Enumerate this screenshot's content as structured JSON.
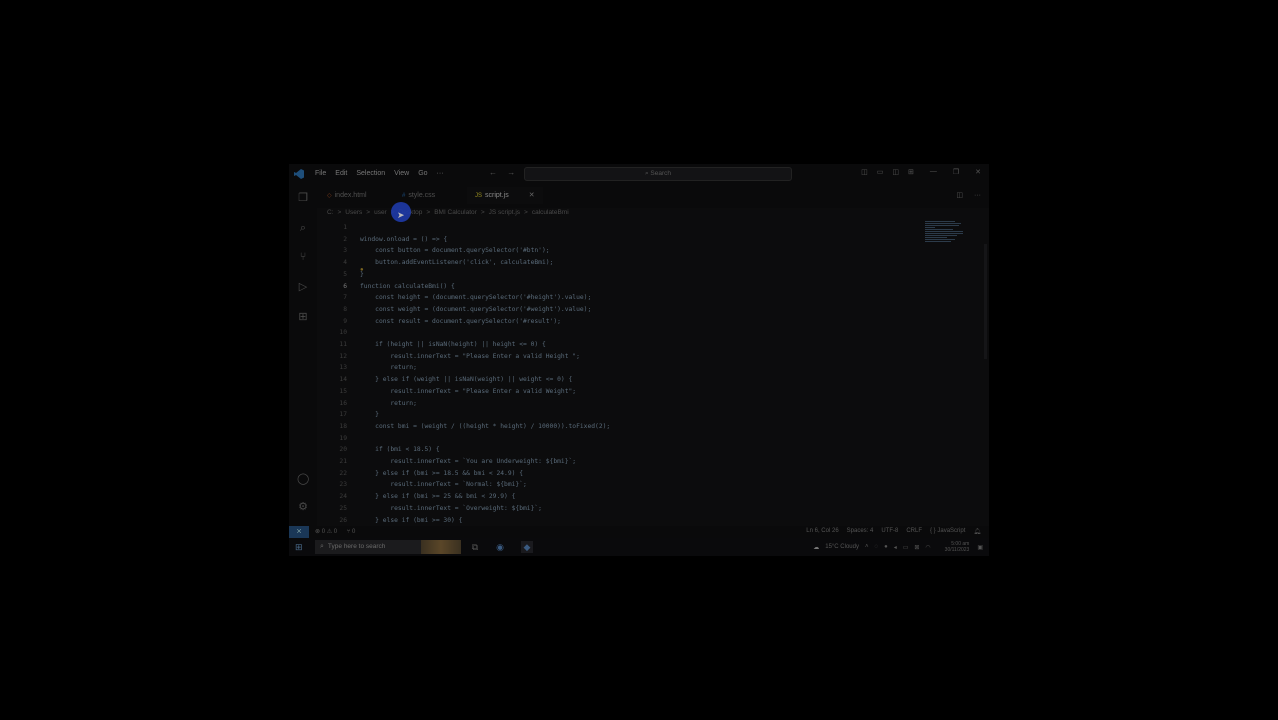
{
  "titlebar": {
    "menu": [
      "File",
      "Edit",
      "Selection",
      "View",
      "Go",
      "···"
    ],
    "search_placeholder": "Search"
  },
  "tabs": [
    {
      "label": "index.html",
      "icon": "html-icon",
      "color": "#7a3a1a"
    },
    {
      "label": "style.css",
      "icon": "css-icon",
      "color": "#1a4a7a"
    },
    {
      "label": "script.js",
      "icon": "js-icon",
      "color": "#9a9020",
      "active": true
    }
  ],
  "breadcrumb": [
    "C:",
    ">",
    "Users",
    ">",
    "user",
    ">",
    "Desktop",
    ">",
    "BMI Calculator",
    ">",
    "JS script.js",
    ">",
    "calculateBmi"
  ],
  "code_lines": [
    {
      "n": "1",
      "text": ""
    },
    {
      "n": "2",
      "text": "window.onload = () => {"
    },
    {
      "n": "3",
      "text": "    const button = document.querySelector('#btn');"
    },
    {
      "n": "4",
      "text": "    button.addEventListener('click', calculateBmi);"
    },
    {
      "n": "5",
      "text": "}"
    },
    {
      "n": "6",
      "text": "function calculateBmi() {",
      "active": true
    },
    {
      "n": "7",
      "text": "    const height = (document.querySelector('#height').value);"
    },
    {
      "n": "8",
      "text": "    const weight = (document.querySelector('#weight').value);"
    },
    {
      "n": "9",
      "text": "    const result = document.querySelector('#result');"
    },
    {
      "n": "10",
      "text": ""
    },
    {
      "n": "11",
      "text": "    if (height || isNaN(height) || height <= 0) {"
    },
    {
      "n": "12",
      "text": "        result.innerText = \"Please Enter a valid Height \";"
    },
    {
      "n": "13",
      "text": "        return;"
    },
    {
      "n": "14",
      "text": "    } else if (weight || isNaN(weight) || weight <= 0) {"
    },
    {
      "n": "15",
      "text": "        result.innerText = \"Please Enter a valid Weight\";"
    },
    {
      "n": "16",
      "text": "        return;"
    },
    {
      "n": "17",
      "text": "    }"
    },
    {
      "n": "18",
      "text": "    const bmi = (weight / ((height * height) / 10000)).toFixed(2);"
    },
    {
      "n": "19",
      "text": ""
    },
    {
      "n": "20",
      "text": "    if (bmi < 18.5) {"
    },
    {
      "n": "21",
      "text": "        result.innerText = `You are Underweight: ${bmi}`;"
    },
    {
      "n": "22",
      "text": "    } else if (bmi >= 18.5 && bmi < 24.9) {"
    },
    {
      "n": "23",
      "text": "        result.innerText = `Normal: ${bmi}`;"
    },
    {
      "n": "24",
      "text": "    } else if (bmi >= 25 && bmi < 29.9) {"
    },
    {
      "n": "25",
      "text": "        result.innerText = `Overweight: ${bmi}`;"
    },
    {
      "n": "26",
      "text": "    } else if (bmi >= 30) {"
    }
  ],
  "statusbar": {
    "errors": "⊗ 0 ⚠ 0",
    "ports": "⑂ 0",
    "position": "Ln 6, Col 26",
    "spaces": "Spaces: 4",
    "encoding": "UTF-8",
    "eol": "CRLF",
    "language": "{ } JavaScript"
  },
  "taskbar": {
    "search_placeholder": "Type here to search",
    "weather": "15°C Cloudy",
    "time": "5:00 am",
    "date": "30/11/2023"
  },
  "colors": {
    "accent": "#1a3757",
    "cursor_highlight": "#1e3aa8"
  }
}
